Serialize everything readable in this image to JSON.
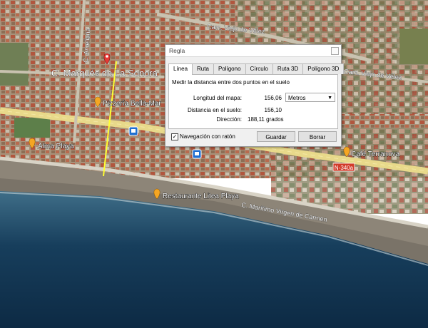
{
  "map": {
    "street_main": "C. Marqués de La Sonora",
    "street_side": "C. Ameliaria",
    "road_top": "Cam. Viejo de Vélez",
    "road_right": "Cam. Viejo de Vélez",
    "road_coast": "C. Marítimo Virgen de Carmen",
    "road_badge": "N-340a",
    "pois": [
      {
        "label": "Pizzería Bella-Mar"
      },
      {
        "label": "Alma Playa"
      },
      {
        "label": "Restaurante Litea Playa"
      },
      {
        "label": "Café Terranova"
      }
    ]
  },
  "dialog": {
    "title": "Regla",
    "tabs": [
      "Línea",
      "Ruta",
      "Polígono",
      "Círculo",
      "Ruta 3D",
      "Polígono 3D"
    ],
    "active_tab": "Línea",
    "description": "Medir la distancia entre dos puntos en el suelo",
    "map_length_label": "Longitud del mapa:",
    "map_length_value": "156,06",
    "unit": "Metros",
    "ground_distance_label": "Distancia en el suelo:",
    "ground_distance_value": "156,10",
    "heading_label": "Dirección:",
    "heading_value": "188,11 grados",
    "mouse_nav_label": "Navegación con ratón",
    "mouse_nav_checked": true,
    "save_button": "Guardar",
    "clear_button": "Borrar"
  }
}
